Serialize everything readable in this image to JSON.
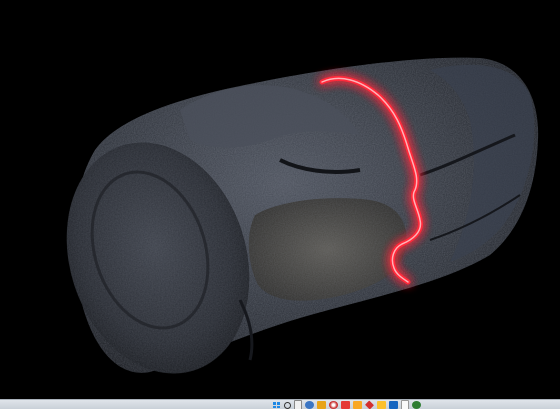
{
  "viewer": {
    "background": "#000000",
    "object": "rock-core-sample",
    "highlight_color": "#ff2a3a"
  },
  "taskbar": {
    "icons": [
      "windows-start-icon",
      "search-icon",
      "file-icon",
      "settings-gear-icon",
      "folder-icon",
      "browser-icon",
      "mail-icon",
      "cloud-icon",
      "diamond-app-icon",
      "yellow-app-icon",
      "blue-app-icon",
      "document-icon",
      "green-app-icon"
    ]
  }
}
